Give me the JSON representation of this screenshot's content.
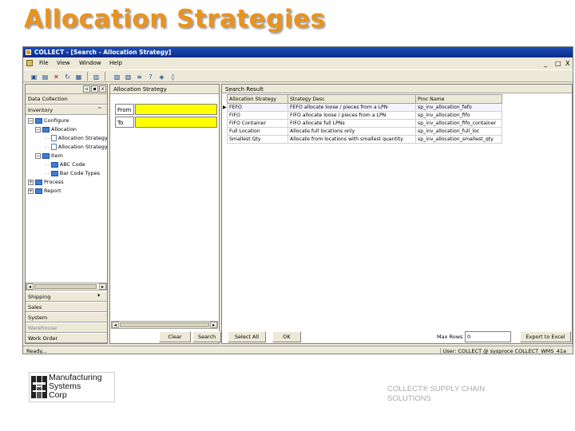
{
  "slide": {
    "title": "Allocation Strategies",
    "footer_line1": "COLLECT® SUPPLY CHAIN",
    "footer_line2": "SOLUTIONS",
    "logo_lines": [
      "Manufacturing",
      "Systems",
      "Corp"
    ]
  },
  "window": {
    "title": "COLLECT - [Search - Allocation Strategy]",
    "controls": [
      "_",
      "□",
      "X"
    ]
  },
  "menu": [
    "File",
    "View",
    "Window",
    "Help"
  ],
  "toolbar": {
    "icons": [
      "save-icon",
      "new-icon",
      "delete-icon",
      "refresh-icon",
      "export-icon",
      "print-icon",
      "properties-icon",
      "help-icon",
      "nav-icon"
    ]
  },
  "sidebar": {
    "header": "Data Collection",
    "section": "Inventory",
    "tree": [
      {
        "label": "Configure",
        "toggle": "−",
        "kind": "folder",
        "level": 0
      },
      {
        "label": "Allocation",
        "toggle": "−",
        "kind": "folder",
        "level": 1
      },
      {
        "label": "Allocation Strategy",
        "toggle": "",
        "kind": "doc",
        "level": 2
      },
      {
        "label": "Allocation Strategy Rule",
        "toggle": "",
        "kind": "doc",
        "level": 2
      },
      {
        "label": "Item",
        "toggle": "−",
        "kind": "folder",
        "level": 1
      },
      {
        "label": "ABC Code",
        "toggle": "",
        "kind": "folder",
        "level": 2
      },
      {
        "label": "Bar Code Types",
        "toggle": "",
        "kind": "folder",
        "level": 2
      },
      {
        "label": "Process",
        "toggle": "+",
        "kind": "folder",
        "level": 0
      },
      {
        "label": "Report",
        "toggle": "+",
        "kind": "folder",
        "level": 0
      }
    ],
    "nav": [
      "Shipping",
      "Sales",
      "System",
      "Warehouse",
      "Work Order"
    ]
  },
  "criteria": {
    "header": "Allocation Strategy",
    "from_label": "From",
    "to_label": "To",
    "from_value": "",
    "to_value": ""
  },
  "results": {
    "header": "Search Result",
    "columns": [
      "Allocation Strategy",
      "Strategy Desc",
      "Proc Name"
    ],
    "rows": [
      [
        "FEFO",
        "FEFO allocate loose / pieces from a LPN",
        "sp_inv_allocation_fefo"
      ],
      [
        "FIFO",
        "FIFO allocate loose / pieces from a LPN",
        "sp_inv_allocation_fifo"
      ],
      [
        "FIFO Container",
        "FIFO allocate full LPNs",
        "sp_inv_allocation_fifo_container"
      ],
      [
        "Full Location",
        "Allocate full locations only",
        "sp_inv_allocation_full_loc"
      ],
      [
        "Smallest Qty",
        "Allocate from locations with smallest quantity",
        "sp_inv_allocation_smallest_qty"
      ]
    ]
  },
  "buttons": {
    "clear": "Clear",
    "search": "Search",
    "select_all": "Select All",
    "ok": "OK",
    "max_rows_label": "Max Rows",
    "max_rows_value": "0",
    "export": "Export to Excel"
  },
  "status": {
    "left": "Ready...",
    "right": "User: COLLECT @ sysproce COLLECT_WMS_41a"
  }
}
